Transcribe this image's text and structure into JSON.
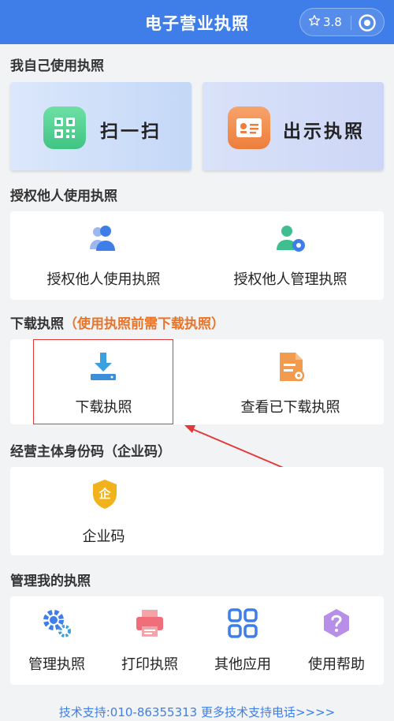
{
  "header": {
    "title": "电子营业执照",
    "rating": "3.8"
  },
  "sections": {
    "own": {
      "title": "我自己使用执照",
      "scan": "扫一扫",
      "show": "出示执照"
    },
    "authorize": {
      "title": "授权他人使用执照",
      "use": "授权他人使用执照",
      "manage": "授权他人管理执照"
    },
    "download": {
      "title": "下载执照",
      "note": "（使用执照前需下载执照）",
      "download": "下载执照",
      "view": "查看已下载执照"
    },
    "entity": {
      "title": "经营主体身份码（企业码）",
      "code": "企业码",
      "badge_char": "企"
    },
    "manage": {
      "title": "管理我的执照",
      "items": [
        "管理执照",
        "打印执照",
        "其他应用",
        "使用帮助"
      ]
    }
  },
  "footer": {
    "text": "技术支持:010-86355313  更多技术支持电话>>>>"
  },
  "colors": {
    "header": "#3f7ee8",
    "accent_orange": "#e8742a",
    "highlight_red": "#e23a3a",
    "link": "#3f7ee8"
  }
}
